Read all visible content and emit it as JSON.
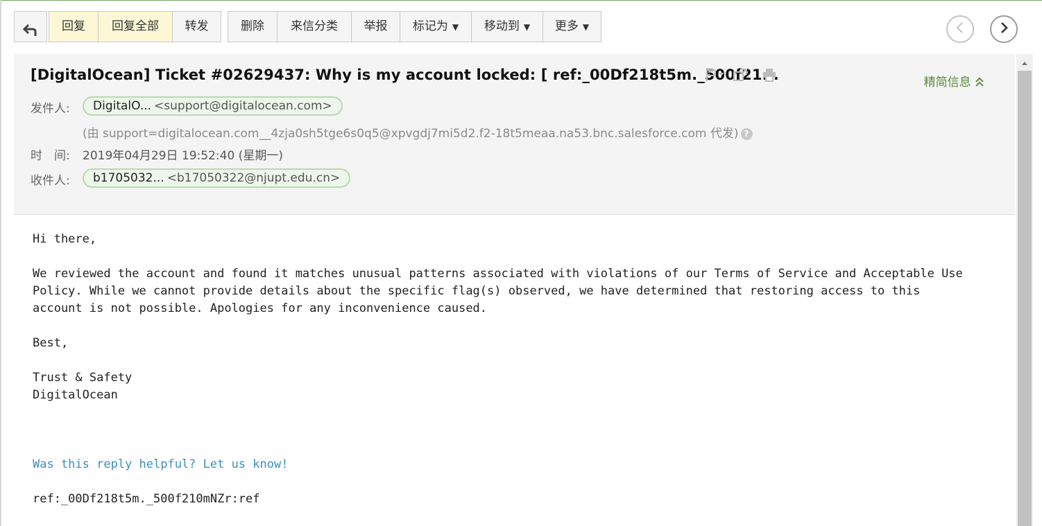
{
  "toolbar": {
    "back": "back-arrow-icon",
    "reply": "回复",
    "reply_all": "回复全部",
    "forward": "转发",
    "delete": "删除",
    "classify": "来信分类",
    "report": "举报",
    "mark_as": "标记为",
    "move_to": "移动到",
    "more": "更多"
  },
  "header": {
    "subject": "[DigitalOcean] Ticket #02629437: Why is my account locked: [ ref:_00Df218t5m._500f21...",
    "brief_label": "精简信息",
    "from_label": "发件人:",
    "from_name": "DigitalO...",
    "from_address": "<support@digitalocean.com>",
    "via_text": "(由 support=digitalocean.com__4zja0sh5tge6s0q5@xpvgdj7mi5d2.f2-18t5meaa.na53.bnc.salesforce.com 代发)",
    "help_glyph": "?",
    "time_label": "时　间:",
    "time_value": "2019年04月29日 19:52:40 (星期一)",
    "to_label": "收件人:",
    "to_name": "b1705032...",
    "to_address": "<b17050322@njupt.edu.cn>"
  },
  "body": {
    "greeting": "Hi there,",
    "p1_l1": "We reviewed the account and found it matches unusual patterns associated with violations of our Terms of Service and Acceptable Use",
    "p1_l2": "Policy. While we cannot provide details about the specific flag(s) observed, we have determined that restoring access to this",
    "p1_l3": "account is not possible. Apologies for any inconvenience caused.",
    "signoff": "Best,",
    "team": "Trust & Safety",
    "company": "DigitalOcean",
    "feedback_link": "Was this reply helpful? Let us know!",
    "ref": "ref:_00Df218t5m._500f210mNZr:ref"
  },
  "colors": {
    "highlight_button": "#fdf7d6",
    "pill_bg": "#edf6ea",
    "pill_border": "#b8d9b0",
    "brief_green": "#5a8a3c",
    "link_blue": "#3a8fc0"
  }
}
